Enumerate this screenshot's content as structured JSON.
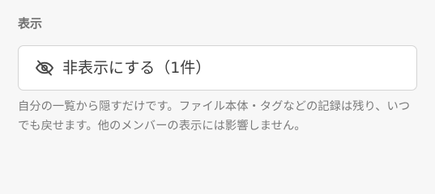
{
  "section": {
    "title": "表示"
  },
  "hide_button": {
    "label": "非表示にする（1件）",
    "icon": "eye-off-icon"
  },
  "description": {
    "text": "自分の一覧から隠すだけです。ファイル本体・タグなどの記録は残り、いつでも戻せます。他のメンバーの表示には影響しません。"
  },
  "colors": {
    "background": "#f7f7f7",
    "button_background": "#ffffff",
    "button_border": "#d4d4d4",
    "title_text": "#6f6f6f",
    "body_text": "#3b3b3b",
    "muted_text": "#7a7a7a"
  }
}
